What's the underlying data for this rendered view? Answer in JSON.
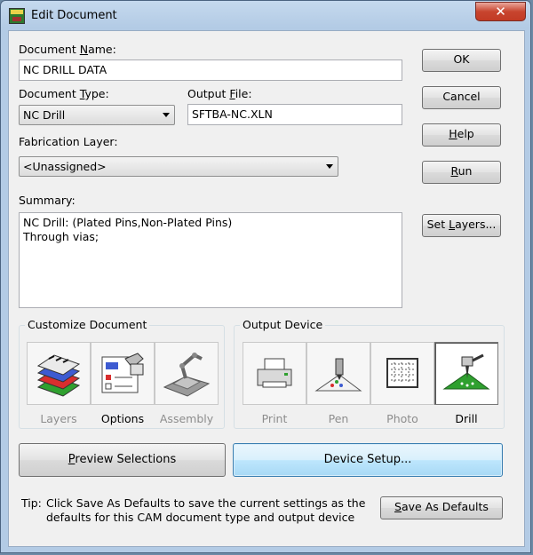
{
  "window": {
    "title": "Edit Document",
    "close_glyph": "✕"
  },
  "fields": {
    "document_name": {
      "label_pre": "Document ",
      "label_u": "N",
      "label_post": "ame:",
      "value": "NC DRILL DATA"
    },
    "document_type": {
      "label_pre": "Document ",
      "label_u": "T",
      "label_post": "ype:",
      "value": "NC Drill"
    },
    "output_file": {
      "label_pre": "Output ",
      "label_u": "F",
      "label_post": "ile:",
      "value": "SFTBA-NC.XLN"
    },
    "fabrication_layer": {
      "label": "Fabrication Layer:",
      "value": "<Unassigned>"
    },
    "summary": {
      "label": "Summary:",
      "lines": [
        "NC Drill: (Plated Pins,Non-Plated Pins)",
        "Through vias;"
      ]
    }
  },
  "buttons": {
    "ok": "OK",
    "cancel": "Cancel",
    "help_pre": "",
    "help_u": "H",
    "help_post": "elp",
    "run_pre": "",
    "run_u": "R",
    "run_post": "un",
    "set_layers_pre": "Set ",
    "set_layers_u": "L",
    "set_layers_post": "ayers...",
    "preview_pre": "",
    "preview_u": "P",
    "preview_post": "review Selections",
    "device_setup": "Device Setup...",
    "save_defaults_pre": "",
    "save_defaults_u": "S",
    "save_defaults_post": "ave As Defaults"
  },
  "customize_document": {
    "title": "Customize Document",
    "items": [
      {
        "label": "Layers",
        "icon": "layers-icon",
        "enabled": false
      },
      {
        "label": "Options",
        "icon": "options-icon",
        "enabled": true
      },
      {
        "label": "Assembly",
        "icon": "assembly-icon",
        "enabled": false
      }
    ]
  },
  "output_device": {
    "title": "Output Device",
    "items": [
      {
        "label": "Print",
        "icon": "printer-icon",
        "enabled": false
      },
      {
        "label": "Pen",
        "icon": "pen-plotter-icon",
        "enabled": false
      },
      {
        "label": "Photo",
        "icon": "photo-icon",
        "enabled": false
      },
      {
        "label": "Drill",
        "icon": "drill-icon",
        "enabled": true,
        "selected": true
      }
    ]
  },
  "tip": {
    "prefix": "Tip:",
    "text": "Click Save As Defaults to save the current settings as the defaults for this CAM document type and output device"
  }
}
